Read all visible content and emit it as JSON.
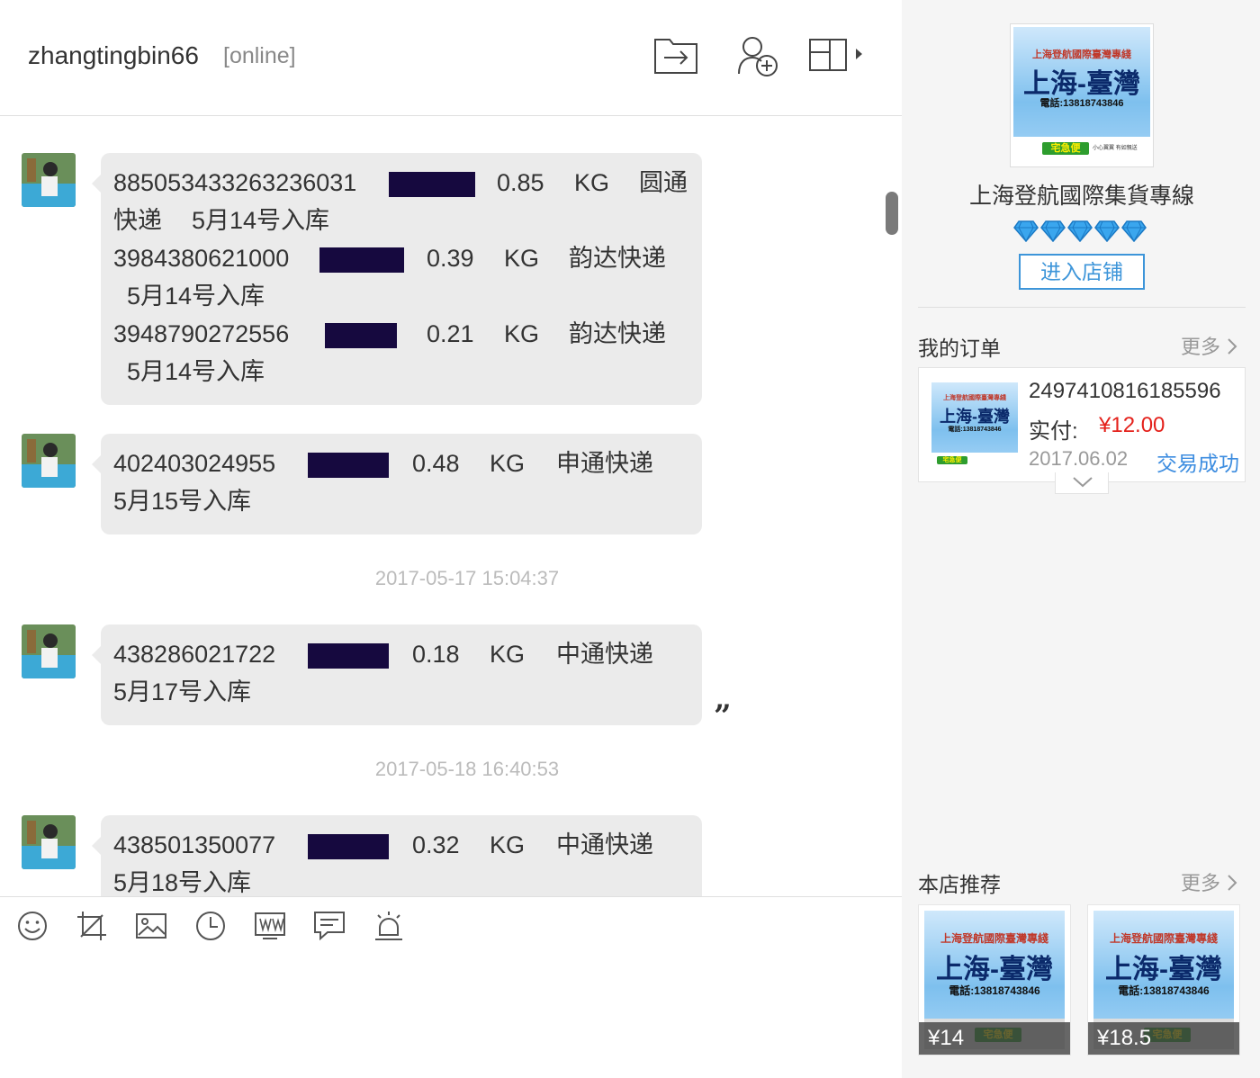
{
  "chat": {
    "username": "zhangtingbin66",
    "status": "[online]",
    "messages": [
      {
        "lines": [
          {
            "tracking": "885053433263236031",
            "weight": "0.85",
            "unit": "KG",
            "courier": "圆通"
          },
          {
            "cont": "快递",
            "date": "5月14号入库"
          },
          {
            "tracking": "3984380621000",
            "weight": "0.39",
            "unit": "KG",
            "courier": "韵达快递"
          },
          {
            "date": "5月14号入库"
          },
          {
            "tracking": "3948790272556",
            "weight": "0.21",
            "unit": "KG",
            "courier": "韵达快递"
          },
          {
            "date": "5月14号入库"
          }
        ]
      },
      {
        "lines": [
          {
            "tracking": "402403024955",
            "weight": "0.48",
            "unit": "KG",
            "courier": "申通快递"
          },
          {
            "date": "5月15号入库"
          }
        ]
      },
      {
        "timestamp": "2017-05-17 15:04:37"
      },
      {
        "lines": [
          {
            "tracking": "438286021722",
            "weight": "0.18",
            "unit": "KG",
            "courier": "中通快递"
          },
          {
            "date": "5月17号入库"
          }
        ]
      },
      {
        "timestamp": "2017-05-18 16:40:53"
      },
      {
        "lines": [
          {
            "tracking": "438501350077",
            "weight": "0.32",
            "unit": "KG",
            "courier": "中通快递"
          },
          {
            "date": "5月18号入库"
          }
        ]
      }
    ],
    "quote_glyph": "”",
    "toolbar_icons": [
      "emoji-icon",
      "screenshot-icon",
      "image-icon",
      "clock-icon",
      "word-icon",
      "chat-bubble-icon",
      "alarm-icon"
    ]
  },
  "sidebar": {
    "shop_image": {
      "top_text": "上海登航國際臺灣專綫",
      "big_text": "上海-臺灣",
      "phone": "電話:13818743846",
      "logo_text": "宅急便",
      "logo_sub": "小心翼翼 有如親送"
    },
    "shop_name": "上海登航國際集貨專線",
    "diamond_count": 5,
    "enter_shop_label": "进入店铺",
    "orders": {
      "title": "我的订单",
      "more_label": "更多",
      "order_number": "2497410816185596",
      "paid_label": "实付:",
      "price": "¥12.00",
      "date": "2017.06.02",
      "status": "交易成功"
    },
    "recommend": {
      "title": "本店推荐",
      "more_label": "更多",
      "items": [
        {
          "price": "¥14"
        },
        {
          "price": "¥18.5"
        }
      ]
    },
    "colors": {
      "accent_blue": "#3d95d9",
      "price_red": "#e4211b",
      "redaction": "#16093f"
    }
  }
}
